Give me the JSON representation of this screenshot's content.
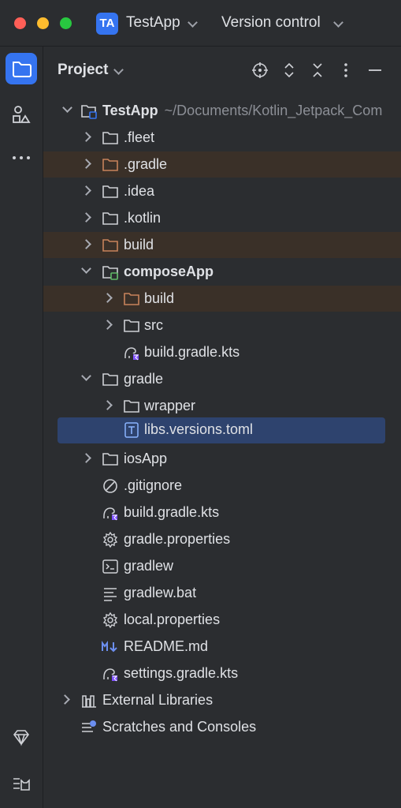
{
  "titlebar": {
    "project_badge": "TA",
    "project_name": "TestApp",
    "vcs_label": "Version control"
  },
  "panel": {
    "title": "Project"
  },
  "tree": {
    "root": {
      "label": "TestApp",
      "path": "~/Documents/Kotlin_Jetpack_Com"
    },
    "items": [
      {
        "label": ".fleet"
      },
      {
        "label": ".gradle"
      },
      {
        "label": ".idea"
      },
      {
        "label": ".kotlin"
      },
      {
        "label": "build"
      },
      {
        "label": "composeApp"
      },
      {
        "label": "build"
      },
      {
        "label": "src"
      },
      {
        "label": "build.gradle.kts"
      },
      {
        "label": "gradle"
      },
      {
        "label": "wrapper"
      },
      {
        "label": "libs.versions.toml"
      },
      {
        "label": "iosApp"
      },
      {
        "label": ".gitignore"
      },
      {
        "label": "build.gradle.kts"
      },
      {
        "label": "gradle.properties"
      },
      {
        "label": "gradlew"
      },
      {
        "label": "gradlew.bat"
      },
      {
        "label": "local.properties"
      },
      {
        "label": "README.md"
      },
      {
        "label": "settings.gradle.kts"
      },
      {
        "label": "External Libraries"
      },
      {
        "label": "Scratches and Consoles"
      }
    ]
  },
  "icons": {
    "folder": "folder-icon",
    "module": "module-folder-icon",
    "gradle": "gradle-kts-icon",
    "toml": "toml-file-icon",
    "settings": "gear-icon",
    "terminal": "shell-script-icon",
    "text": "text-file-icon",
    "markdown": "markdown-icon",
    "ignore": "gitignore-icon"
  },
  "colors": {
    "accent": "#3574f0",
    "selection": "#2e436e",
    "excluded_row": "#3a3028",
    "excluded_folder": "#c7825b",
    "module_badge": "#5fb865"
  }
}
